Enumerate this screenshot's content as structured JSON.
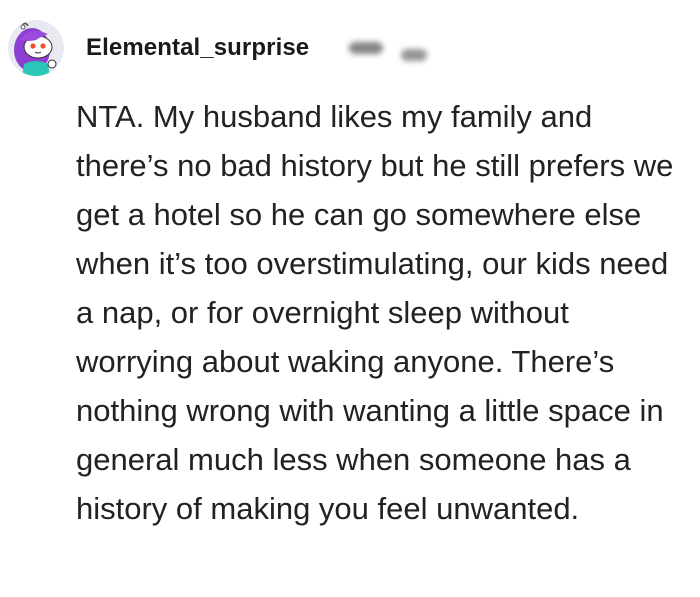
{
  "comment": {
    "author": "Elemental_surprise",
    "avatar_icon": "snoo-avatar-purple-hair",
    "body": "NTA. My husband likes my family and there’s no bad history but he still prefers we get a hotel so he can go somewhere else when it’s too overstimulating, our kids need a nap, or for overnight sleep without worrying about waking anyone. There’s nothing wrong with wanting a little space in general much less when someone has a history of making you feel unwanted."
  },
  "colors": {
    "text": "#222222",
    "author": "#1a1a1b",
    "background": "#ffffff",
    "avatar_hair": "#8e3fd1",
    "avatar_shirt": "#2cc6b8"
  }
}
